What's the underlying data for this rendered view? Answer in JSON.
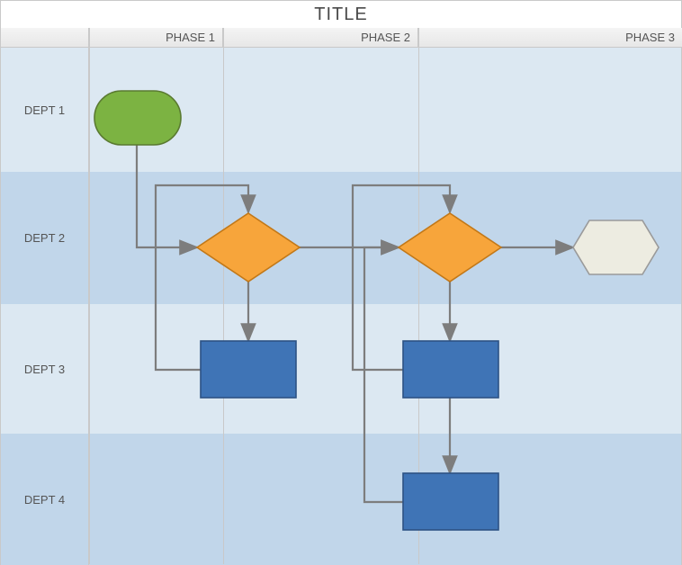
{
  "title": "TITLE",
  "phases": [
    "PHASE 1",
    "PHASE 2",
    "PHASE 3"
  ],
  "depts": [
    "DEPT 1",
    "DEPT 2",
    "DEPT 3",
    "DEPT 4"
  ],
  "colors": {
    "lane_light": "#dce8f2",
    "lane_dark": "#c1d6ea",
    "terminator_fill": "#7cb342",
    "terminator_stroke": "#5a7a31",
    "decision_fill": "#f7a53b",
    "decision_stroke": "#c27818",
    "process_fill": "#3f74b6",
    "process_stroke": "#2c5284",
    "hex_fill": "#edece1",
    "hex_stroke": "#9a9a9a",
    "arrow": "#7d7d7d"
  },
  "chart_data": {
    "type": "flowchart-swimlane",
    "title": "TITLE",
    "columns": [
      "PHASE 1",
      "PHASE 2",
      "PHASE 3"
    ],
    "rows": [
      "DEPT 1",
      "DEPT 2",
      "DEPT 3",
      "DEPT 4"
    ],
    "nodes": [
      {
        "id": "start",
        "shape": "terminator",
        "row": "DEPT 1",
        "col": "PHASE 1"
      },
      {
        "id": "dec1",
        "shape": "decision",
        "row": "DEPT 2",
        "col": "PHASE 1"
      },
      {
        "id": "proc1",
        "shape": "process",
        "row": "DEPT 3",
        "col": "PHASE 1"
      },
      {
        "id": "dec2",
        "shape": "decision",
        "row": "DEPT 2",
        "col": "PHASE 2"
      },
      {
        "id": "proc2",
        "shape": "process",
        "row": "DEPT 3",
        "col": "PHASE 2"
      },
      {
        "id": "proc3",
        "shape": "process",
        "row": "DEPT 4",
        "col": "PHASE 2"
      },
      {
        "id": "end",
        "shape": "preparation",
        "row": "DEPT 2",
        "col": "PHASE 3"
      }
    ],
    "edges": [
      {
        "from": "start",
        "to": "dec1"
      },
      {
        "from": "dec1",
        "to": "proc1"
      },
      {
        "from": "proc1",
        "to": "dec1",
        "loop": true
      },
      {
        "from": "dec1",
        "to": "dec2"
      },
      {
        "from": "dec2",
        "to": "proc2"
      },
      {
        "from": "proc2",
        "to": "dec2",
        "loop": true
      },
      {
        "from": "proc2",
        "to": "proc3"
      },
      {
        "from": "proc3",
        "to": "dec2",
        "loop": true
      },
      {
        "from": "dec2",
        "to": "end"
      }
    ]
  }
}
